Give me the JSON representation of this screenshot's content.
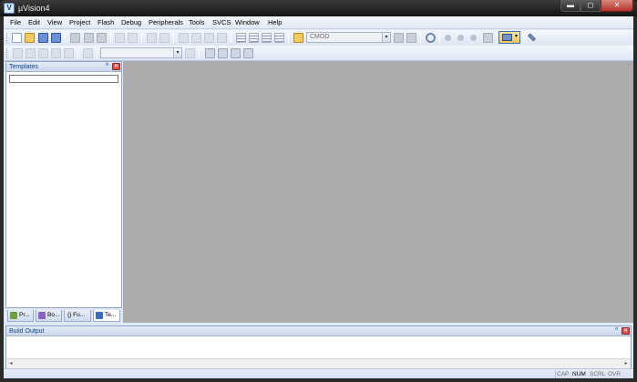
{
  "window": {
    "title": "µVision4",
    "app_icon_letter": "V",
    "minimize_glyph": "▬",
    "maximize_glyph": "◻",
    "close_glyph": "✕"
  },
  "menu": [
    "File",
    "Edit",
    "View",
    "Project",
    "Flash",
    "Debug",
    "Peripherals",
    "Tools",
    "SVCS",
    "Window",
    "Help"
  ],
  "toolbar": {
    "target_combo": {
      "value": "CMOD",
      "arrow": "▾"
    },
    "find_combo": {
      "value": "",
      "arrow": "▾"
    },
    "config_dropdown_arrow": "▾"
  },
  "templates_panel": {
    "title": "Templates",
    "pin_glyph": "ª",
    "close_glyph": "✕",
    "filter_value": ""
  },
  "panel_tabs": [
    {
      "label": "Pr...",
      "icon": "project-icon",
      "color": "#6f9e3f"
    },
    {
      "label": "Bo...",
      "icon": "books-icon",
      "color": "#8a62c2"
    },
    {
      "label": "{} Fu...",
      "icon": "functions-icon",
      "color": "#5a78b6"
    },
    {
      "label": "Te...",
      "icon": "templates-icon",
      "color": "#3b6cc2",
      "active": true
    }
  ],
  "build_output": {
    "title": "Build Output",
    "pin_glyph": "ª",
    "close_glyph": "✕",
    "scroll_left": "◂",
    "scroll_right": "▸"
  },
  "status": {
    "indicators": [
      {
        "label": "CAP",
        "on": false
      },
      {
        "label": "NUM",
        "on": true
      },
      {
        "label": "SCRL",
        "on": false
      },
      {
        "label": "OVR",
        "on": false
      }
    ]
  },
  "colors": {
    "editor_background": "#ababab",
    "frame": "#dfe8f6",
    "accent": "#15428b"
  }
}
